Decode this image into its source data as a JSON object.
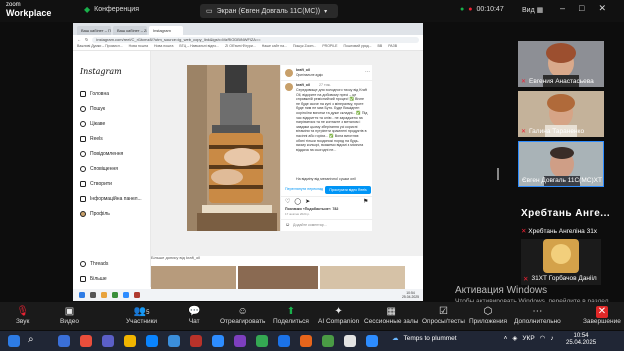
{
  "zoom": {
    "logo_top": "zoom",
    "logo_bottom": "Workplace",
    "conference_label": "Конференция",
    "share_label": "Экран (Євген Довгаль 11С(МС))",
    "timer": "00:10:47",
    "view_label": "Вид",
    "accent": "#2d8cff",
    "record_color": "#19b04b"
  },
  "browser": {
    "tabs": [
      "Ваш кабінет – Промислов...",
      "Ваш кабінет – Zoom",
      "Instagram"
    ],
    "url": "instagram.com/reel/C_ri1tcmz8/?utm_source=ig_web_copy_link&igsh=MzRlODBiNWFlZA==",
    "bookmarks": [
      "Важливі Думки – Промисл...",
      "Нова пошта",
      "Нова пошта",
      "ВГЦ – Навчальні відео...",
      "ZI Об'ємні Фігури...",
      "Наше сайт на...",
      "Пошук Zoom...",
      "PROPILE",
      "Поштовий уряд...",
      "ВВ",
      "РАЗВ"
    ]
  },
  "instagram": {
    "logo": "Instagram",
    "nav": [
      {
        "label": "Головна",
        "icon": "home-icon"
      },
      {
        "label": "Пошук",
        "icon": "search-icon"
      },
      {
        "label": "Цікаве",
        "icon": "compass-icon"
      },
      {
        "label": "Reels",
        "icon": "reels-icon"
      },
      {
        "label": "Повідомлення",
        "icon": "messenger-icon"
      },
      {
        "label": "Сповіщення",
        "icon": "heart-icon"
      },
      {
        "label": "Створити",
        "icon": "plus-icon"
      },
      {
        "label": "Інформаційна панел...",
        "icon": "dashboard-icon"
      },
      {
        "label": "Профіль",
        "icon": "avatar-icon"
      }
    ],
    "bottom_nav": [
      {
        "label": "Threads",
        "icon": "threads-icon"
      },
      {
        "label": "Більше",
        "icon": "menu-icon"
      }
    ],
    "notif_counts": {
      "likes": "1",
      "followers": "1"
    },
    "post": {
      "username": "kraft_oil",
      "subtitle": "Оригінальне аудіо",
      "caption_user": "kraft_oil",
      "caption_time": "27 тиж.",
      "caption": "Середовище для холодного тиску від Kraft Oil, відкрите на добовому пресі – це справжній реміснийчий процес! ✅ Вічне не буде скоче на купі з мінералму, проте буде ним не має Буто. Буде Вишіднен ооріноїни виготки та дуже складні... ✅ Під час відкриття та олію - не зараджено на нагріватися та не контакте з металом і завдяки цьому зберігання усі корисні вітаміни та нутрієнти зрамлені продуктів в насінні або горіхи... ✅ Вона виготляє обяні тільки поодинокі поряд на будь-якому кольорі, вкажемо відомі з місячна віддача на сьогодні не...",
      "more_text": "На відміну від механічної сушки олії",
      "see_translation": "Переглянути переклад",
      "reel_button": "Прослухати відео Reels",
      "likes": "Позначки «Подобається»: 782",
      "date": "17 жовтня 2024 р.",
      "comment_placeholder": "Додайте коментар..."
    },
    "more_from": "Більше допису від kraft_oil"
  },
  "participants": [
    {
      "name": "Евгения Анастасьева",
      "muted": true
    },
    {
      "name": "Галина Тараненко",
      "muted": true
    },
    {
      "name": "Євген Довгаль 11С(МС)ХТ",
      "muted": false,
      "active": true
    },
    {
      "name": "Хребтань Ангеліна 31х",
      "big_name": "Хребтань Анге...",
      "muted": true
    },
    {
      "name": "31ХТ Горбачов Данііл",
      "muted": true
    }
  ],
  "activation": {
    "title": "Активация Windows",
    "text": "Чтобы активировать Windows, перейдите в раздел «Параметры»."
  },
  "toolbar": [
    {
      "label": "Звук",
      "icon": "mic-muted-icon"
    },
    {
      "label": "Видео",
      "icon": "video-icon"
    },
    {
      "label": "Участники",
      "icon": "participants-icon",
      "count": "5"
    },
    {
      "label": "Чат",
      "icon": "chat-icon"
    },
    {
      "label": "Отреагировать",
      "icon": "reaction-icon"
    },
    {
      "label": "Поделиться",
      "icon": "share-icon"
    },
    {
      "label": "AI Companion",
      "icon": "ai-companion-icon"
    },
    {
      "label": "Сессионные залы",
      "icon": "breakout-icon"
    },
    {
      "label": "Опросы/тесты",
      "icon": "polls-icon"
    },
    {
      "label": "Приложения",
      "icon": "apps-icon"
    },
    {
      "label": "Дополнительно",
      "icon": "more-icon"
    },
    {
      "label": "Завершение",
      "icon": "end-icon"
    }
  ],
  "taskbar": {
    "weather": "Temps to plummet",
    "lang": "УКР",
    "time": "10:54",
    "date": "25.04.2025",
    "inner_time": "10:54",
    "inner_date": "25.04.2025"
  }
}
